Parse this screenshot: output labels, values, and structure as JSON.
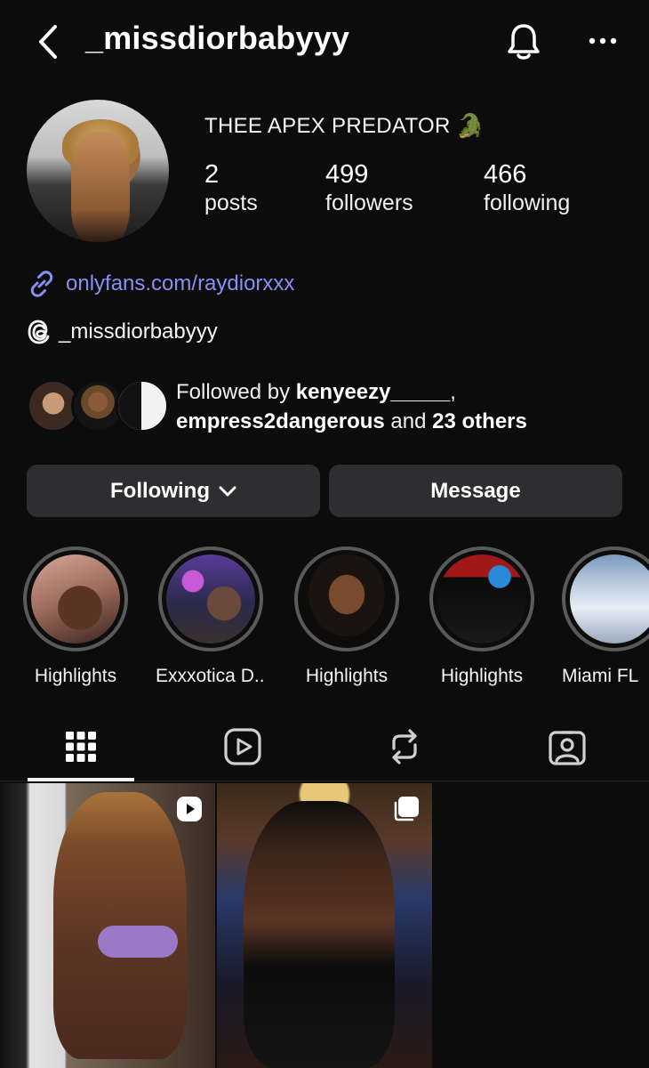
{
  "header": {
    "username": "_missdiorbabyyy",
    "back_icon": "chevron-left-icon",
    "bell_icon": "bell-icon",
    "more_icon": "more-horizontal-icon"
  },
  "profile": {
    "display_name": "THEE APEX PREDATOR",
    "name_emoji": "🐊",
    "stats": [
      {
        "value": "2",
        "label": "posts"
      },
      {
        "value": "499",
        "label": "followers"
      },
      {
        "value": "466",
        "label": "following"
      }
    ],
    "link": "onlyfans.com/raydiorxxx",
    "threads_handle": "_missdiorbabyyy"
  },
  "followed_by": {
    "prefix": "Followed by ",
    "user1": "kenyeezy_____",
    "comma": ",",
    "user2": "empress2dangerous",
    "and_text": " and ",
    "others": "23 others"
  },
  "actions": {
    "following_label": "Following",
    "message_label": "Message"
  },
  "highlights": [
    {
      "label": "Highlights"
    },
    {
      "label": "Exxxotica D..."
    },
    {
      "label": "Highlights"
    },
    {
      "label": "Highlights"
    },
    {
      "label": "Miami FL"
    }
  ],
  "tabs": [
    "grid-icon",
    "reels-icon",
    "reposts-icon",
    "tagged-icon"
  ],
  "colors": {
    "background": "#0c0c0c",
    "link": "#8b8ff5",
    "button": "#2e2e31"
  }
}
